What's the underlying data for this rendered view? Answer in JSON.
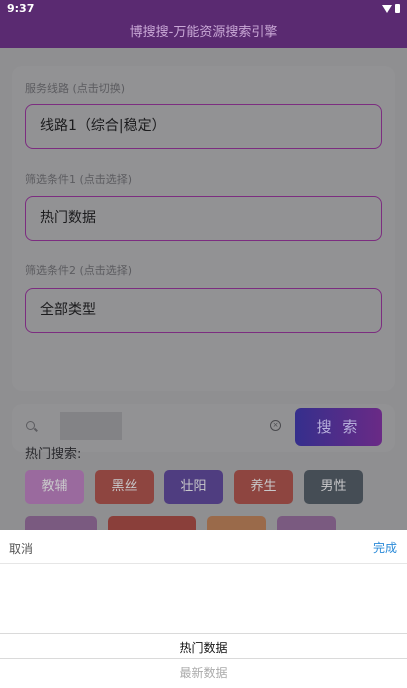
{
  "status_bar": {
    "time": "9:37"
  },
  "app": {
    "title": "博搜搜-万能资源搜索引擎"
  },
  "route_section": {
    "label": "服务线路 (点击切换)",
    "value": "线路1（综合|稳定）"
  },
  "filter1_section": {
    "label": "筛选条件1 (点击选择)",
    "value": "热门数据"
  },
  "filter2_section": {
    "label": "筛选条件2 (点击选择)",
    "value": "全部类型"
  },
  "search": {
    "button_label": "搜 索",
    "clear_glyph": "×"
  },
  "hot": {
    "title": "热门搜索:",
    "tags": [
      {
        "label": "教辅",
        "color": "#9a6a9e"
      },
      {
        "label": "黑丝",
        "color": "#8e4540"
      },
      {
        "label": "壮阳",
        "color": "#4f3d80"
      },
      {
        "label": "养生",
        "color": "#8e4540"
      },
      {
        "label": "男性",
        "color": "#454d55"
      },
      {
        "label": "",
        "color": "#7a5a80"
      },
      {
        "label": "",
        "color": "#8a3f3a"
      },
      {
        "label": "",
        "color": "#9a6a4a"
      },
      {
        "label": "",
        "color": "#7a5a80"
      }
    ]
  },
  "picker": {
    "cancel_label": "取消",
    "done_label": "完成",
    "options": [
      "热门数据",
      "最新数据"
    ]
  }
}
